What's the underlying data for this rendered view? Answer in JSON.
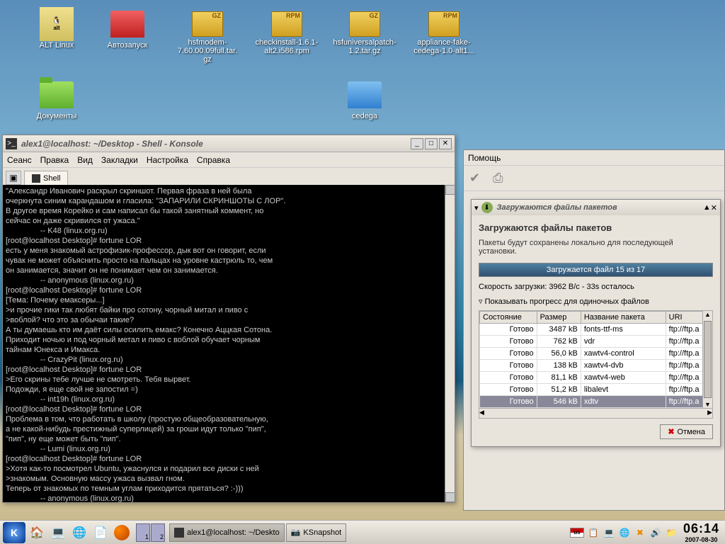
{
  "desktop_icons": [
    {
      "label": "ALT Linux",
      "type": "alt"
    },
    {
      "label": "Автозапуск",
      "type": "folder-r"
    },
    {
      "label": "hsfmodem-7.60.00.09full.tar.gz",
      "type": "gz"
    },
    {
      "label": "checkinstall-1.6.1-alt2.i586.rpm",
      "type": "rpm"
    },
    {
      "label": "hsfuniversalpatch-1.2.tar.gz",
      "type": "gz"
    },
    {
      "label": "appliance-fake-cedega-1.0-alt1...",
      "type": "rpm"
    },
    {
      "label": "Документы",
      "type": "folder-g"
    },
    {
      "label": "cedega",
      "type": "folder-b"
    }
  ],
  "konsole": {
    "title": "alex1@localhost: ~/Desktop - Shell - Konsole",
    "menus": [
      "Сеанс",
      "Правка",
      "Вид",
      "Закладки",
      "Настройка",
      "Справка"
    ],
    "tab": "Shell",
    "content": "\"Александр Иванович раскрыл скриншот. Первая фраза в ней была\nочеркнута синим карандашом и гласила: \"ЗАПАРИЛИ СКРИНШОТЫ С ЛОР\".\nВ другое время Корейко и сам написал бы такой занятный коммент, но\nсейчас он даже скривился от ужаса.\"\n                -- K48 (linux.org.ru)\n[root@localhost Desktop]# fortune LOR\nесть у меня знакомый астрофизик-профессор, дык вот он говорит, если\nчувак не может объяснить просто на пальцах на уровне кастрюль то, чем\nон занимается, значит он не понимает чем он занимается.\n                -- anonymous (linux.org.ru)\n[root@localhost Desktop]# fortune LOR\n[Тема: Почему емаксеры...]\n>и прочие гики так любят байки про сотону, чорный митал и пиво с\n>воблой? что это за обычаи такие?\nА ты думаешь кто им даёт силы осилить емакс? Конечно Аццкая Сотона.\nПриходит ночью и под чорный метал и пиво с воблой обучает чорным\nтайнам Юнекса и Имакса.\n                -- CrazyPit (linux.org.ru)\n[root@localhost Desktop]# fortune LOR\n>Его скрины тебе лучше не смотреть. Тебя вырвет.\nПодожди, я еще свой не запостил =)\n                -- int19h (linux.org.ru)\n[root@localhost Desktop]# fortune LOR\nПроблема в том, что работать в школу (простую общеобразовательную,\nа не какой-нибудь престижный суперлицей) за гроши идут только \"пип\",\n\"пип\", ну еще может быть \"пип\".\n                -- Lumi (linux.org.ru)\n[root@localhost Desktop]# fortune LOR\n>Хотя как-то посмотрел Ubuntu, ужаснулся и подарил все диски с ней\n>знакомым. Основную массу ужаса вызвал гном.\nТеперь от знакомых по темным углам приходится прятаться? :-)))\n                -- anonymous (linux.org.ru)\n[root@localhost Desktop]# "
  },
  "behind_menu": "Помощь",
  "download": {
    "title": "Загружаются файлы пакетов",
    "heading": "Загружаются файлы пакетов",
    "desc": "Пакеты будут сохранены локально для последующей установки.",
    "progress_text": "Загружается файл 15 из 17",
    "speed": "Скорость загрузки: 3962  B/c - 33s осталось",
    "expander": "Показывать прогресс для одиночных файлов",
    "cols": [
      "Состояние",
      "Размер",
      "Название пакета",
      "URI"
    ],
    "rows": [
      {
        "s": "Готово",
        "size": "3487 kB",
        "name": "fonts-ttf-ms",
        "uri": "ftp://ftp.a"
      },
      {
        "s": "Готово",
        "size": "762 kB",
        "name": "vdr",
        "uri": "ftp://ftp.a"
      },
      {
        "s": "Готово",
        "size": "56,0 kB",
        "name": "xawtv4-control",
        "uri": "ftp://ftp.a"
      },
      {
        "s": "Готово",
        "size": "138 kB",
        "name": "xawtv4-dvb",
        "uri": "ftp://ftp.a"
      },
      {
        "s": "Готово",
        "size": "81,1 kB",
        "name": "xawtv4-web",
        "uri": "ftp://ftp.a"
      },
      {
        "s": "Готово",
        "size": "51,2 kB",
        "name": "libalevt",
        "uri": "ftp://ftp.a"
      },
      {
        "s": "Готово",
        "size": "546 kB",
        "name": "xdtv",
        "uri": "ftp://ftp.a",
        "sel": true
      }
    ],
    "cancel": "Отмена"
  },
  "taskbar": {
    "tasks": [
      {
        "label": "alex1@localhost: ~/Deskto",
        "active": true
      },
      {
        "label": "KSnapshot",
        "active": false
      }
    ],
    "pager": [
      "1",
      "2"
    ],
    "kb": "us",
    "time": "06:14",
    "date": "2007-08-30"
  }
}
